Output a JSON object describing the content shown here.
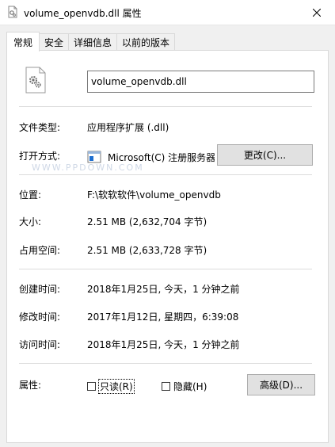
{
  "window": {
    "title": "volume_openvdb.dll 属性",
    "close_glyph": "×"
  },
  "tabs": [
    {
      "label": "常规",
      "active": true
    },
    {
      "label": "安全",
      "active": false
    },
    {
      "label": "详细信息",
      "active": false
    },
    {
      "label": "以前的版本",
      "active": false
    }
  ],
  "general": {
    "filename": "volume_openvdb.dll",
    "file_type_label": "文件类型:",
    "file_type_value": "应用程序扩展 (.dll)",
    "opens_with_label": "打开方式:",
    "opens_with_value": "Microsoft(C) 注册服务器",
    "change_button": "更改(C)...",
    "location_label": "位置:",
    "location_value": "F:\\软软软件\\volume_openvdb",
    "size_label": "大小:",
    "size_value": "2.51 MB (2,632,704 字节)",
    "size_on_disk_label": "占用空间:",
    "size_on_disk_value": "2.51 MB (2,633,728 字节)",
    "created_label": "创建时间:",
    "created_value": "2018年1月25日, 今天，1 分钟之前",
    "modified_label": "修改时间:",
    "modified_value": "2017年1月12日, 星期四，6:39:08",
    "accessed_label": "访问时间:",
    "accessed_value": "2018年1月25日, 今天，1 分钟之前",
    "attributes_label": "属性:",
    "readonly_label": "只读(R)",
    "readonly_checked": false,
    "hidden_label": "隐藏(H)",
    "hidden_checked": false,
    "advanced_button": "高级(D)..."
  },
  "watermark": "WWW.PPDOWN.COM",
  "colors": {
    "window_bg": "#f0f0f0",
    "panel_bg": "#ffffff",
    "button_bg": "#e1e1e1",
    "border": "#d9d9d9"
  },
  "icons": {
    "title": "dll-file-icon",
    "file": "dll-gear-file-icon",
    "app": "registry-server-icon",
    "close": "close-icon"
  }
}
